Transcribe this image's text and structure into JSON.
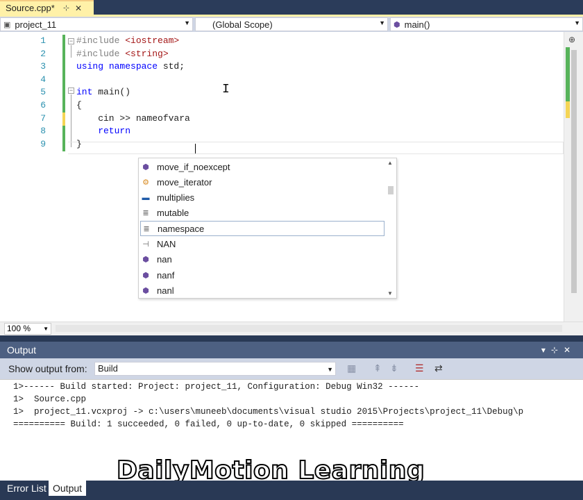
{
  "tab": {
    "title": "Source.cpp*",
    "pin": "⊹",
    "close": "✕"
  },
  "nav": {
    "project": "project_11",
    "scope": "(Global Scope)",
    "member": "main()"
  },
  "editor": {
    "line_numbers": [
      "1",
      "2",
      "3",
      "4",
      "5",
      "6",
      "7",
      "8",
      "9"
    ],
    "lines": [
      {
        "parts": [
          {
            "t": "#include ",
            "c": "pp"
          },
          {
            "t": "<iostream>",
            "c": "str"
          }
        ]
      },
      {
        "parts": [
          {
            "t": "#include ",
            "c": "pp"
          },
          {
            "t": "<string>",
            "c": "str"
          }
        ]
      },
      {
        "parts": [
          {
            "t": "using ",
            "c": "kw"
          },
          {
            "t": "namespace ",
            "c": "kw"
          },
          {
            "t": "std;",
            "c": ""
          }
        ]
      },
      {
        "parts": []
      },
      {
        "parts": [
          {
            "t": "int ",
            "c": "kw"
          },
          {
            "t": "main()",
            "c": ""
          }
        ]
      },
      {
        "parts": [
          {
            "t": "{",
            "c": ""
          }
        ]
      },
      {
        "parts": [
          {
            "t": "    cin >> nameofvara",
            "c": ""
          }
        ]
      },
      {
        "parts": [
          {
            "t": "    return",
            "c": "kw"
          }
        ]
      },
      {
        "parts": [
          {
            "t": "}",
            "c": ""
          }
        ]
      }
    ],
    "zoom": "100 %"
  },
  "intellisense": {
    "items": [
      {
        "label": "move_if_noexcept",
        "icon": "function-icon",
        "glyph": "⬢",
        "cls": "c-purple"
      },
      {
        "label": "move_iterator",
        "icon": "class-template-icon",
        "glyph": "⚙",
        "cls": "c-orange"
      },
      {
        "label": "multiplies",
        "icon": "struct-icon",
        "glyph": "▬",
        "cls": "c-blue"
      },
      {
        "label": "mutable",
        "icon": "keyword-icon",
        "glyph": "≣",
        "cls": "c-gray"
      },
      {
        "label": "namespace",
        "icon": "keyword-icon",
        "glyph": "≣",
        "cls": "c-gray"
      },
      {
        "label": "NAN",
        "icon": "macro-icon",
        "glyph": "⊣",
        "cls": "c-gray"
      },
      {
        "label": "nan",
        "icon": "function-icon",
        "glyph": "⬢",
        "cls": "c-purple"
      },
      {
        "label": "nanf",
        "icon": "function-icon",
        "glyph": "⬢",
        "cls": "c-purple"
      },
      {
        "label": "nanl",
        "icon": "function-icon",
        "glyph": "⬢",
        "cls": "c-purple"
      }
    ],
    "selected_index": 4
  },
  "output": {
    "title": "Output",
    "show_from_label": "Show output from:",
    "source": "Build",
    "lines": [
      "1>------ Build started: Project: project_11, Configuration: Debug Win32 ------",
      "1>  Source.cpp",
      "1>  project_11.vcxproj -> c:\\users\\muneeb\\documents\\visual studio 2015\\Projects\\project_11\\Debug\\p",
      "========== Build: 1 succeeded, 0 failed, 0 up-to-date, 0 skipped =========="
    ]
  },
  "watermark": "DailyMotion Learning",
  "bottom_tabs": [
    {
      "label": "Error List"
    },
    {
      "label": "Output"
    }
  ]
}
